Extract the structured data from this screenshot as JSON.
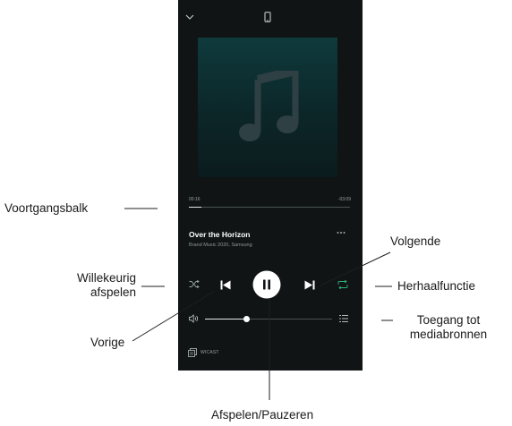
{
  "player": {
    "progress": {
      "elapsed": "00:16",
      "remaining": "-03:09",
      "fraction": 0.08
    },
    "volume_fraction": 0.33,
    "track": {
      "title": "Over the Horizon",
      "subtitle": "Brand Music 2020, Samsung"
    },
    "cast_label": "WICAST",
    "icons": {
      "collapse": "chevron-down-icon",
      "device": "phone-icon",
      "artwork": "music-note-icon",
      "more": "more-icon",
      "shuffle": "shuffle-icon",
      "previous": "previous-icon",
      "play_pause": "pause-icon",
      "next": "next-icon",
      "repeat": "repeat-icon",
      "volume": "volume-icon",
      "media_sources": "queue-icon",
      "cast": "cast-icon"
    },
    "colors": {
      "background": "#101415",
      "accent": "#2db07a",
      "text": "#ffffff",
      "muted": "#8f9899"
    }
  },
  "annotations": {
    "progress_bar": "Voortgangsbalk",
    "next": "Volgende",
    "shuffle_line1": "Willekeurig",
    "shuffle_line2": "afspelen",
    "repeat": "Herhaalfunctie",
    "media_line1": "Toegang tot",
    "media_line2": "mediabronnen",
    "previous": "Vorige",
    "play_pause": "Afspelen/Pauzeren"
  }
}
